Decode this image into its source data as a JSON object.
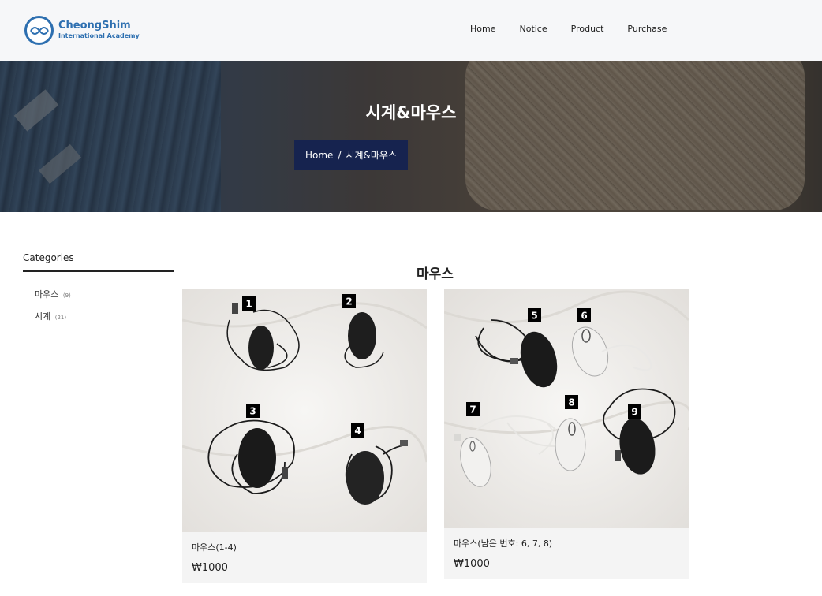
{
  "brand": {
    "name": "CheongShim",
    "subtitle": "International Academy"
  },
  "nav": [
    {
      "label": "Home"
    },
    {
      "label": "Notice"
    },
    {
      "label": "Product"
    },
    {
      "label": "Purchase"
    }
  ],
  "hero": {
    "title": "시계&마우스",
    "breadcrumb": {
      "home": "Home",
      "separator": "/",
      "current": "시계&마우스"
    }
  },
  "sidebar": {
    "title": "Categories",
    "categories": [
      {
        "label": "마우스",
        "count": "(9)"
      },
      {
        "label": "시계",
        "count": "(21)"
      }
    ]
  },
  "main": {
    "section_title": "마우스",
    "products": [
      {
        "name": "마우스(1-4)",
        "price": "₩1000",
        "photo_numbers": [
          "1",
          "2",
          "3",
          "4"
        ]
      },
      {
        "name": "마우스(남은 번호: 6, 7, 8)",
        "price": "₩1000",
        "photo_numbers": [
          "5",
          "6",
          "7",
          "8",
          "9"
        ]
      }
    ]
  },
  "colors": {
    "brand_blue": "#2d6fb0",
    "breadcrumb_bg": "#16234f",
    "header_bg": "#f6f7f9",
    "card_bg": "#f4f4f4"
  }
}
